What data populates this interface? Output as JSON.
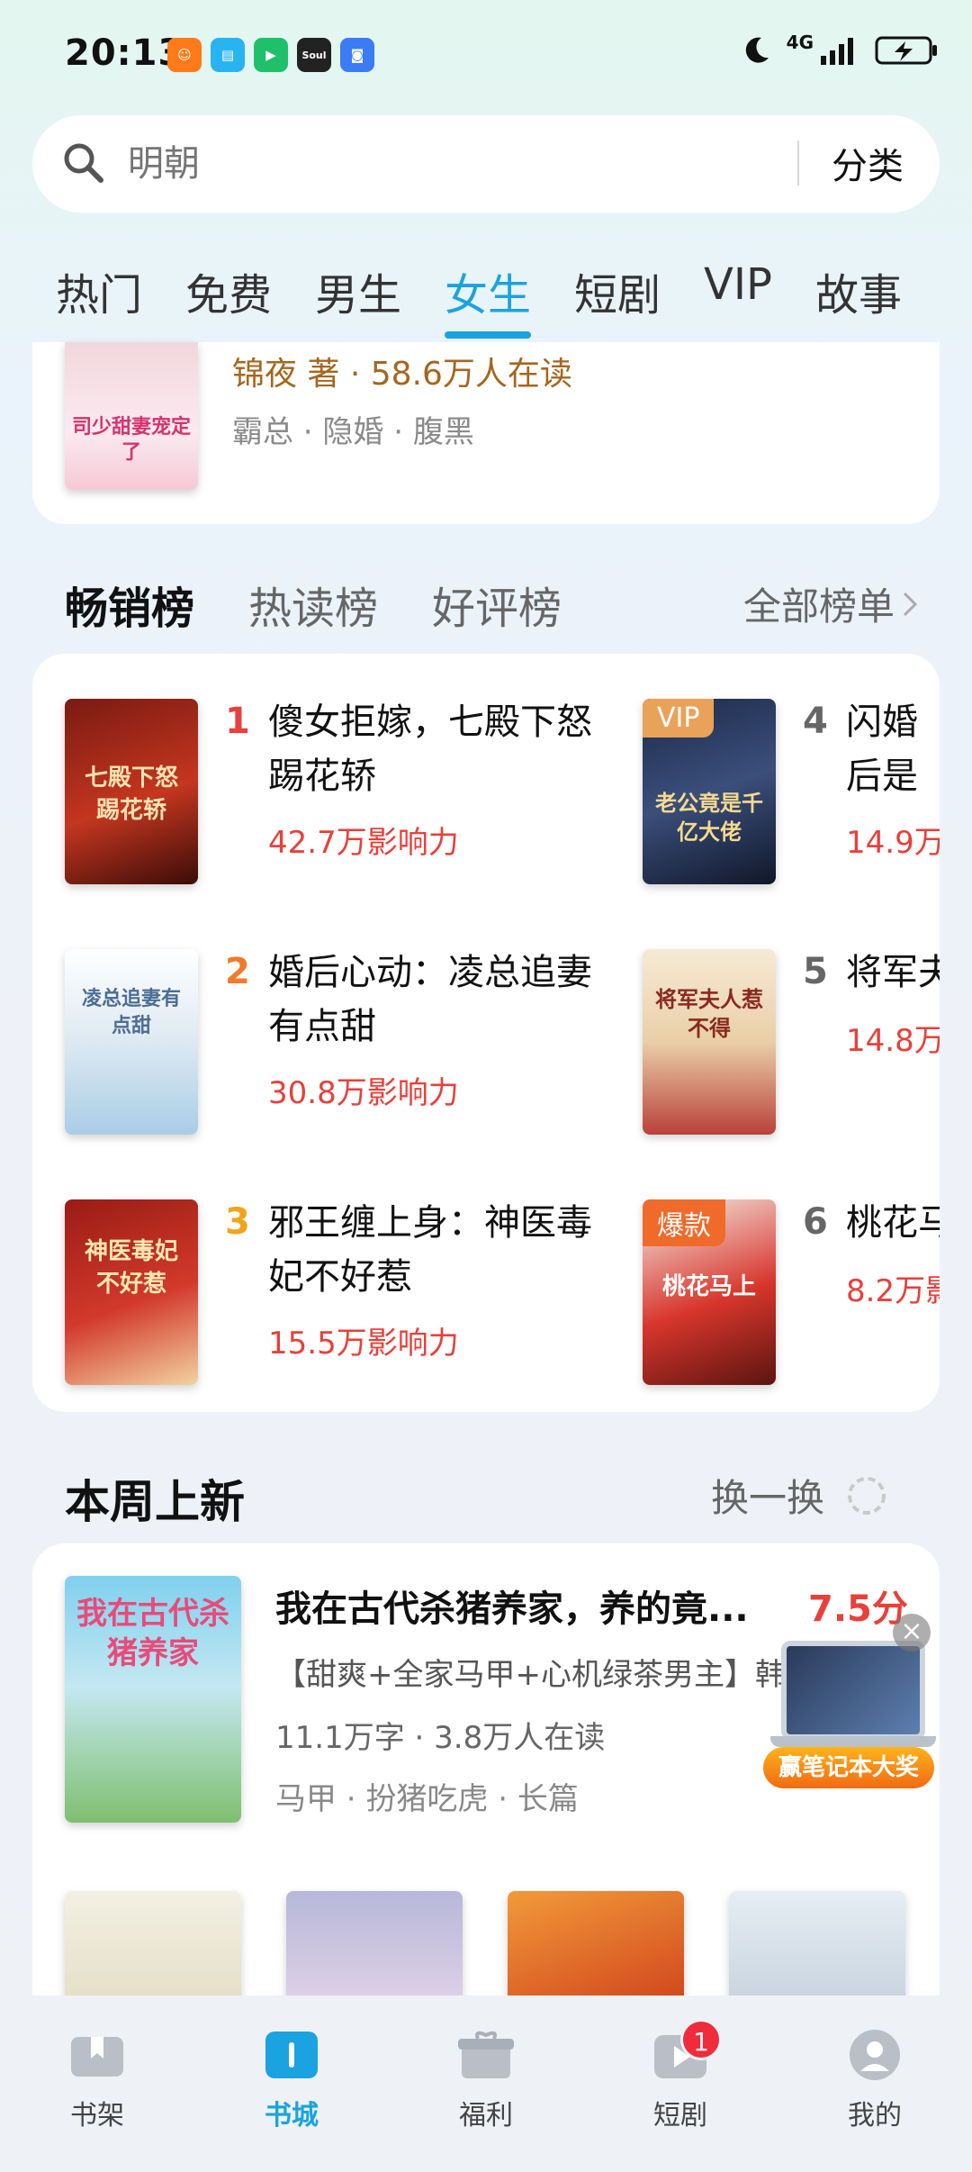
{
  "status_bar": {
    "time": "20:13",
    "app_icons": [
      "taobao-icon",
      "reader-icon",
      "video-icon",
      "soul-icon",
      "browser-icon"
    ],
    "soul_label": "Soul",
    "network": "4G",
    "battery_icon": "battery-charging-icon"
  },
  "search": {
    "placeholder": "明朝",
    "category_label": "分类"
  },
  "tabs": [
    {
      "label": "热门"
    },
    {
      "label": "免费"
    },
    {
      "label": "男生"
    },
    {
      "label": "女生",
      "active": true
    },
    {
      "label": "短剧"
    },
    {
      "label": "VIP"
    },
    {
      "label": "故事"
    }
  ],
  "featured_book": {
    "meta": "锦夜 著 · 58.6万人在读",
    "tags": "霸总 · 隐婚 · 腹黑",
    "cover_text": "司少甜妻宠定了"
  },
  "ranking": {
    "tabs": [
      {
        "label": "畅销榜",
        "active": true
      },
      {
        "label": "热读榜"
      },
      {
        "label": "好评榜"
      }
    ],
    "all_lists_label": "全部榜单",
    "items": [
      {
        "rank": "1",
        "title": "傻女拒嫁，七殿下怒踢花轿",
        "influence": "42.7万影响力",
        "cover_text": "七殿下怒踢花轿"
      },
      {
        "rank": "2",
        "title": "婚后心动：凌总追妻有点甜",
        "influence": "30.8万影响力",
        "cover_text": "凌总追妻有点甜"
      },
      {
        "rank": "3",
        "title": "邪王缠上身：神医毒妃不好惹",
        "influence": "15.5万影响力",
        "cover_text": "神医毒妃不好惹"
      },
      {
        "rank": "4",
        "title": "闪婚后是千亿",
        "influence": "14.9万",
        "badge": "VIP",
        "cover_text": "老公竟是千亿大佬"
      },
      {
        "rank": "5",
        "title": "将军夫",
        "influence": "14.8万",
        "cover_text": "将军夫人惹不得"
      },
      {
        "rank": "6",
        "title": "桃花马",
        "influence": "8.2万影",
        "badge": "爆款",
        "cover_text": "桃花马上"
      }
    ]
  },
  "weekly": {
    "title": "本周上新",
    "refresh_label": "换一换",
    "book": {
      "title": "我在古代杀猪养家，养的竟...",
      "score": "7.5分",
      "intro": "【甜爽+全家马甲+心机绿茶男主】韩",
      "stats": "11.1万字 · 3.8万人在读",
      "tags": "马甲 · 扮猪吃虎 · 长篇",
      "cover_text": "我在古代杀猪养家"
    },
    "promo_label": "赢笔记本大奖"
  },
  "bottom_nav": [
    {
      "label": "书架",
      "icon": "bookshelf-icon"
    },
    {
      "label": "书城",
      "icon": "bookstore-icon",
      "active": true
    },
    {
      "label": "福利",
      "icon": "gift-icon"
    },
    {
      "label": "短剧",
      "icon": "play-icon",
      "badge": "1"
    },
    {
      "label": "我的",
      "icon": "profile-icon"
    }
  ]
}
